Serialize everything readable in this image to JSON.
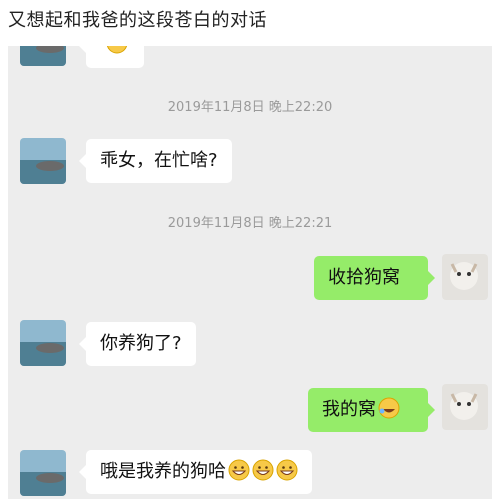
{
  "caption": "又想起和我爸的这段苍白的对话",
  "timestamps": [
    "2019年11月8日 晚上22:20",
    "2019年11月8日 晚上22:21"
  ],
  "messages": [
    {
      "side": "left",
      "text": ""
    },
    {
      "side": "left",
      "text": "乖女，在忙啥?"
    },
    {
      "side": "right",
      "text": "收拾狗窝"
    },
    {
      "side": "left",
      "text": "你养狗了?"
    },
    {
      "side": "right",
      "text": "我的窝",
      "emoji": "laughing-tears-emoji"
    },
    {
      "side": "left",
      "text": "哦是我养的狗哈",
      "emoji": "grin-emoji"
    }
  ],
  "avatars": {
    "father": "lake-landscape-avatar",
    "daughter": "cat-avatar"
  },
  "colors": {
    "chat_bg": "#ededed",
    "right_bubble": "#95ec69",
    "left_bubble": "#ffffff",
    "timestamp": "#9a9a9a"
  }
}
